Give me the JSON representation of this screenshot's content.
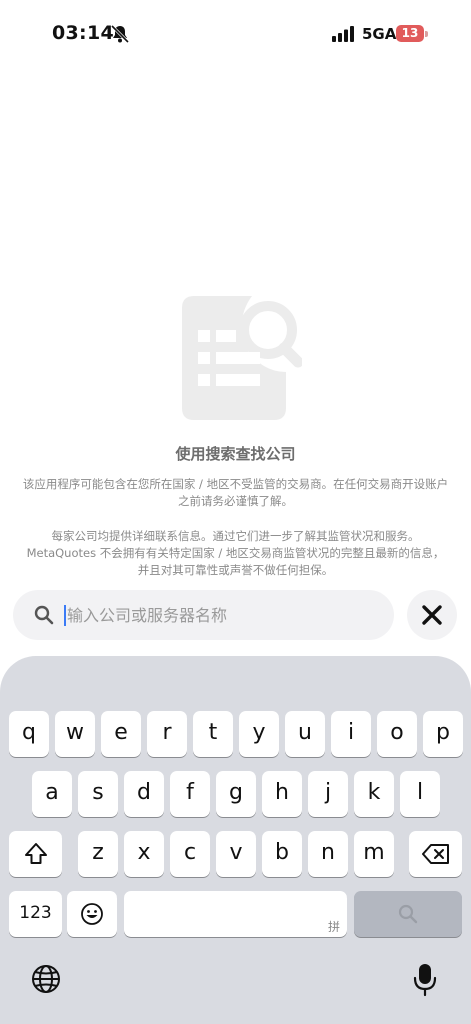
{
  "status_bar": {
    "time": "03:14",
    "network": "5GA",
    "battery_level": "13"
  },
  "empty_state": {
    "title": "使用搜索查找公司",
    "paragraph_1": "该应用程序可能包含在您所在国家 / 地区不受监管的交易商。在任何交易商开设账户之前请务必谨慎了解。",
    "paragraph_2": "每家公司均提供详细联系信息。通过它们进一步了解其监管状况和服务。MetaQuotes 不会拥有有关特定国家 / 地区交易商监管状况的完整且最新的信息，并且对其可靠性或声誉不做任何担保。"
  },
  "search": {
    "placeholder": "输入公司或服务器名称",
    "value": ""
  },
  "keyboard": {
    "row1": [
      "q",
      "w",
      "e",
      "r",
      "t",
      "y",
      "u",
      "i",
      "o",
      "p"
    ],
    "row2": [
      "a",
      "s",
      "d",
      "f",
      "g",
      "h",
      "j",
      "k",
      "l"
    ],
    "row3": [
      "z",
      "x",
      "c",
      "v",
      "b",
      "n",
      "m"
    ],
    "numbers_key": "123",
    "space_hint": "拼"
  },
  "colors": {
    "keyboard_bg": "#d9dbe1",
    "key_bg": "#ffffff",
    "dark_key_bg": "#b3b7c0",
    "battery_low": "#e15b5b",
    "caret": "#3b7bf6"
  },
  "icons": {
    "silent": "bell-slash-icon",
    "signal": "cellular-signal-icon",
    "search": "search-icon",
    "close": "close-icon",
    "shift": "shift-icon",
    "delete": "backspace-icon",
    "emoji": "emoji-icon",
    "search_key": "search-key-icon",
    "globe": "globe-icon",
    "mic": "microphone-icon"
  }
}
